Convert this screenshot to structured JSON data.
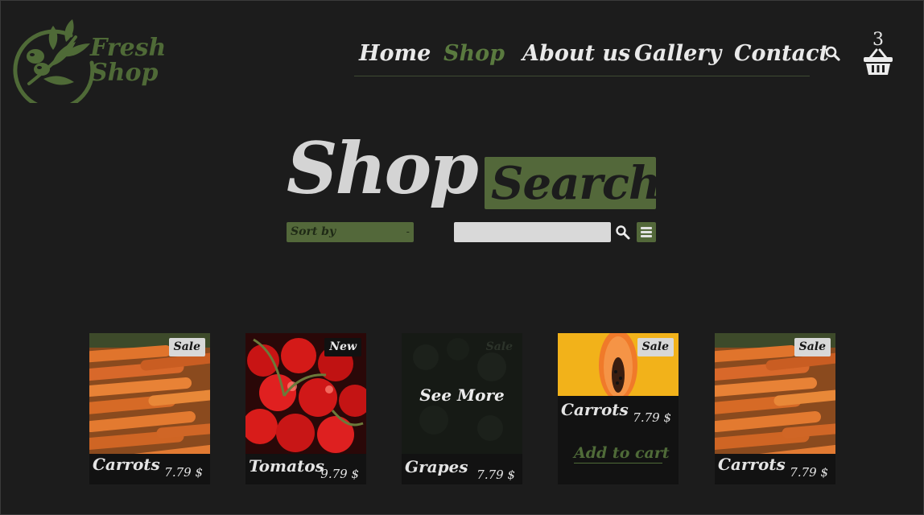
{
  "brand": {
    "line1": "Fresh",
    "line2": "Shop",
    "color": "#4f6a37"
  },
  "nav": {
    "items": [
      {
        "label": "Home",
        "active": false
      },
      {
        "label": "Shop",
        "active": true
      },
      {
        "label": "About us",
        "active": false
      },
      {
        "label": "Gallery",
        "active": false
      },
      {
        "label": "Contact",
        "active": false
      }
    ],
    "search_icon": "search-icon",
    "cart_icon": "basket-icon",
    "cart_count": "3"
  },
  "hero": {
    "title": "Shop",
    "badge": "Search"
  },
  "filters": {
    "sort_label": "Sort by",
    "sort_caret": "-",
    "search_value": "",
    "search_icon": "search-icon",
    "menu_icon": "menu-icon"
  },
  "products": [
    {
      "name": "Carrots",
      "price": "7.79 $",
      "badge": "Sale",
      "image": "carrots"
    },
    {
      "name": "Tomatos",
      "price": "9.79 $",
      "badge": "New",
      "image": "tomatoes"
    },
    {
      "name": "Grapes",
      "price": "7.79 $",
      "badge": "Sale",
      "image": "grapes",
      "overlay": "See More"
    },
    {
      "name": "Carrots",
      "price": "7.79 $",
      "badge": "Sale",
      "image": "papaya",
      "action": "Add to cart"
    },
    {
      "name": "Carrots",
      "price": "7.79 $",
      "badge": "Sale",
      "image": "carrots"
    }
  ],
  "colors": {
    "background": "#1c1c1c",
    "accent": "#53683a",
    "text": "#e6e6e6"
  }
}
